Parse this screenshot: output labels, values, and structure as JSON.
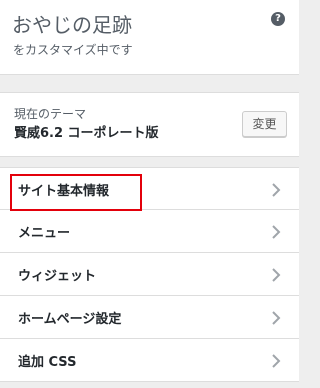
{
  "header": {
    "title": "おやじの足跡",
    "subtitle": "をカスタマイズ中です",
    "help_icon": "question-circle-icon",
    "help_glyph": "?"
  },
  "theme": {
    "label": "現在のテーマ",
    "name": "賢威6.2 コーポレート版",
    "change_label": "変更"
  },
  "nav": {
    "items": [
      {
        "label": "サイト基本情報"
      },
      {
        "label": "メニュー"
      },
      {
        "label": "ウィジェット"
      },
      {
        "label": "ホームページ設定"
      },
      {
        "label": "追加 CSS"
      }
    ],
    "chevron_icon": "chevron-right-icon"
  },
  "annotation": {
    "highlight_color": "#e3000b",
    "highlighted_item": "サイト基本情報"
  }
}
